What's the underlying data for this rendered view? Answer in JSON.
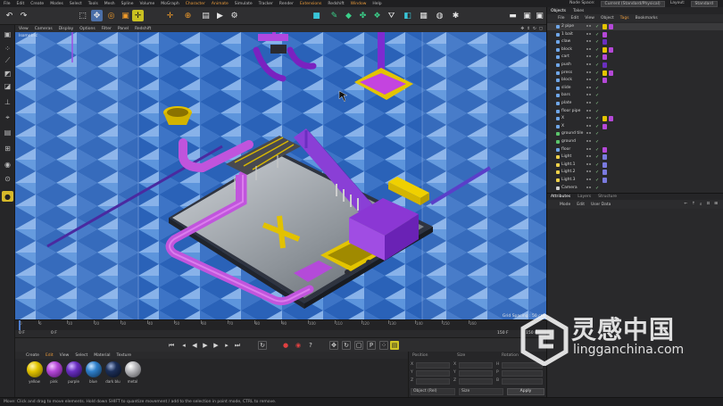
{
  "menubar": {
    "items": [
      "File",
      "Edit",
      "Create",
      "Modes",
      "Select",
      "Tools",
      "Mesh",
      "Spline",
      "Volume",
      "MoGraph",
      "Character",
      "Animate",
      "Simulate",
      "Tracker",
      "Render",
      "Extensions",
      "Redshift",
      "Window",
      "Help"
    ],
    "node_space_label": "Node Space:",
    "node_space_value": "Current (Standard/Physical)",
    "layout_label": "Layout:",
    "layout_value": "Standard"
  },
  "viewport": {
    "menu": [
      "View",
      "Cameras",
      "Display",
      "Options",
      "Filter",
      "Panel",
      "Redshift"
    ],
    "camera_label": "Isometric",
    "grid_spacing": "Grid Spacing : 50 cm"
  },
  "timeline": {
    "ticks": [
      "0",
      "6",
      "10",
      "20",
      "30",
      "40",
      "50",
      "60",
      "70",
      "80",
      "90",
      "100",
      "110",
      "120",
      "130",
      "140",
      "150",
      "160"
    ],
    "current_frame": "0 F",
    "start_frame": "0 F",
    "end_frame": "150 F",
    "max_frame": "150 F"
  },
  "materials": {
    "menu": [
      "Create",
      "Edit",
      "View",
      "Select",
      "Material",
      "Texture"
    ],
    "items": [
      {
        "label": "yellow",
        "color": "#e3c400"
      },
      {
        "label": "pink",
        "color": "#b548d8"
      },
      {
        "label": "purple",
        "color": "#6a2fc0"
      },
      {
        "label": "blue",
        "color": "#2e7fc9"
      },
      {
        "label": "dark blu",
        "color": "#1c2f58"
      },
      {
        "label": "metal",
        "color": "#b9b9bd"
      }
    ]
  },
  "coords": {
    "headers": [
      "Position",
      "Size",
      "Rotation"
    ],
    "x": "X",
    "y": "Y",
    "z": "Z",
    "h": "H",
    "p": "P",
    "b": "B",
    "mode_select": "Object (Rel)",
    "size_select": "Size",
    "apply": "Apply"
  },
  "status": {
    "text": "Move: Click and drag to move elements. Hold down SHIFT to quantize movement / add to the selection in point mode, CTRL to remove."
  },
  "object_manager": {
    "tabs": [
      "Objects",
      "Takes"
    ],
    "menu": [
      "File",
      "Edit",
      "View",
      "Object",
      "Tags",
      "Bookmarks"
    ],
    "objects": [
      {
        "name": "2 pipe",
        "color": "#6fa6e8"
      },
      {
        "name": "1 bait",
        "color": "#6fa6e8"
      },
      {
        "name": "claw",
        "color": "#6fa6e8"
      },
      {
        "name": "block",
        "color": "#6fa6e8"
      },
      {
        "name": "cart",
        "color": "#6fa6e8"
      },
      {
        "name": "push",
        "color": "#6fa6e8"
      },
      {
        "name": "press",
        "color": "#6fa6e8"
      },
      {
        "name": "block",
        "color": "#6fa6e8"
      },
      {
        "name": "slide",
        "color": "#6fa6e8"
      },
      {
        "name": "bars",
        "color": "#6fa6e8"
      },
      {
        "name": "plate",
        "color": "#6fa6e8"
      },
      {
        "name": "floor pipe",
        "color": "#6fa6e8"
      },
      {
        "name": "X",
        "color": "#6fa6e8"
      },
      {
        "name": "X",
        "color": "#6fa6e8"
      },
      {
        "name": "ground tile",
        "color": "#5bc46b"
      },
      {
        "name": "ground",
        "color": "#5bc46b"
      },
      {
        "name": "floor",
        "color": "#6fa6e8"
      },
      {
        "name": "Light",
        "color": "#f0d24a"
      },
      {
        "name": "Light.1",
        "color": "#f0d24a"
      },
      {
        "name": "Light.2",
        "color": "#f0d24a"
      },
      {
        "name": "Light.3",
        "color": "#f0d24a"
      },
      {
        "name": "Camera",
        "color": "#cfcfcf"
      }
    ]
  },
  "attributes": {
    "tabs": [
      "Attributes",
      "Layers",
      "Structure"
    ],
    "menu": [
      "Mode",
      "Edit",
      "User Data"
    ]
  },
  "watermark": {
    "cn": "灵感中国",
    "url": "lingganchina.com"
  }
}
